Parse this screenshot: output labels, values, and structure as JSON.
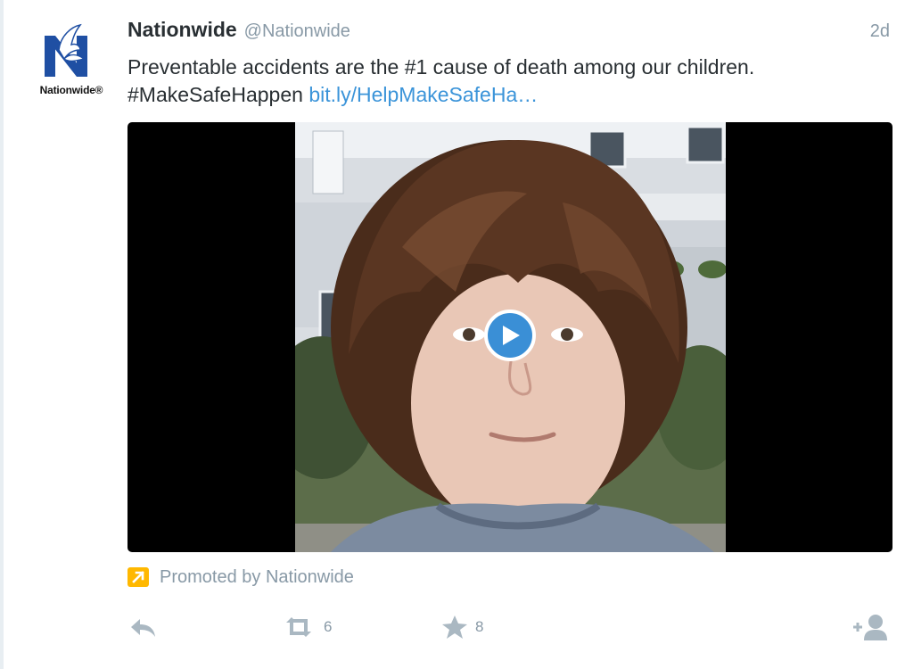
{
  "tweet": {
    "display_name": "Nationwide",
    "handle": "@Nationwide",
    "timestamp": "2d",
    "text_line1": "Preventable accidents are the #1 cause of death among our children.",
    "hashtag": "#MakeSafeHappen",
    "link": "bit.ly/HelpMakeSafeHa…",
    "avatar_label": "Nationwide®",
    "promoted_text": "Promoted by Nationwide",
    "retweet_count": "6",
    "favorite_count": "8"
  },
  "colors": {
    "link": "#3b94d9",
    "muted": "#8899a6",
    "promoted_badge": "#ffb800",
    "play_button": "#3a8fd6",
    "brand_blue": "#1f4fa3"
  },
  "icons": {
    "avatar": "nationwide-eagle-logo",
    "play": "play-icon",
    "promoted": "promoted-arrow-icon",
    "reply": "reply-icon",
    "retweet": "retweet-icon",
    "favorite": "star-icon",
    "follow": "follow-icon"
  }
}
